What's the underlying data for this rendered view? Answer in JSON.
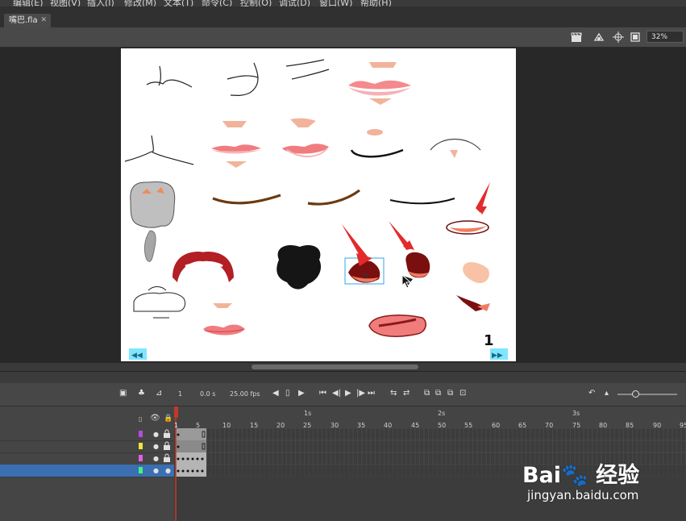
{
  "menu": {
    "items": [
      "编辑(E)",
      "视图(V)",
      "插入(I)",
      "修改(M)",
      "文本(T)",
      "命令(C)",
      "控制(O)",
      "调试(D)",
      "窗口(W)",
      "帮助(H)"
    ]
  },
  "document": {
    "tab_title": "嘴巴.fla",
    "close_glyph": "✕"
  },
  "editbar": {
    "zoom": "32%",
    "icons": [
      "clapper-icon",
      "symbol-edit-icon",
      "center-stage-icon",
      "clip-icon"
    ]
  },
  "stage": {
    "page_number": "1",
    "prev_glyph": "◀◀",
    "next_glyph": "▶▶"
  },
  "timeline": {
    "current_frame": "1",
    "time": "0.0 s",
    "fps": "25.00 fps",
    "ruler": [
      "5",
      "10",
      "15",
      "20",
      "25",
      "30",
      "35",
      "40",
      "45",
      "50",
      "55",
      "60",
      "65",
      "70",
      "75",
      "80",
      "85",
      "90",
      "95"
    ],
    "seconds": [
      "1s",
      "2s",
      "3s"
    ],
    "layers": [
      {
        "color": "#b44cd8",
        "selected": false
      },
      {
        "color": "#f2e33b",
        "selected": false
      },
      {
        "color": "#e25ee8",
        "selected": false
      },
      {
        "color": "#49f07a",
        "selected": true
      }
    ]
  },
  "colors": {
    "accent": "#3a6fb2",
    "playhead": "#c0392b",
    "stage": "#ffffff"
  },
  "watermark": {
    "logo": "Bai🐾 经验",
    "url": "jingyan.baidu.com"
  }
}
